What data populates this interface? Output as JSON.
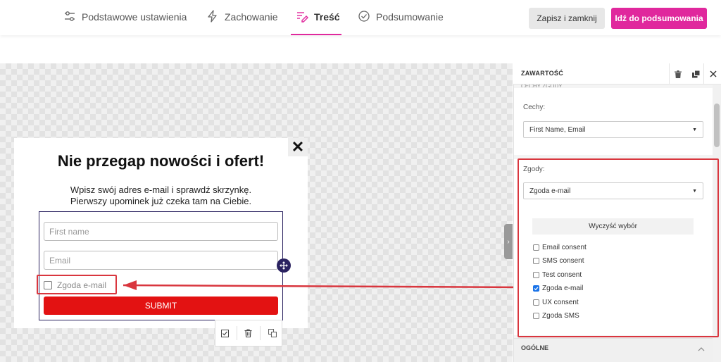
{
  "top_tabs": [
    {
      "label": "Podstawowe ustawienia",
      "icon": "sliders-icon"
    },
    {
      "label": "Zachowanie",
      "icon": "lightning-icon"
    },
    {
      "label": "Treść",
      "icon": "content-edit-icon",
      "active": true
    },
    {
      "label": "Podsumowanie",
      "icon": "check-circle-icon"
    }
  ],
  "buttons": {
    "save_close": "Zapisz i zamknij",
    "go_summary": "Idź do podsumowania"
  },
  "colors": {
    "accent": "#e0289d",
    "submit": "#e31212",
    "highlight": "#d9363e",
    "form_border": "#2a2260"
  },
  "popup": {
    "title": "Nie przegap nowości i ofert!",
    "subtitle_line1": "Wpisz swój adres e-mail i sprawdź skrzynkę.",
    "subtitle_line2": "Pierwszy upominek już czeka tam na Ciebie.",
    "first_name_placeholder": "First name",
    "email_placeholder": "Email",
    "consent_label": "Zgoda e-mail",
    "submit_label": "SUBMIT",
    "close_glyph": "✕"
  },
  "panel": {
    "title": "ZAWARTOŚĆ",
    "partial_section": "CECHY ZGODY",
    "cechy_label": "Cechy:",
    "cechy_value": "First Name, Email",
    "zgody_label": "Zgody:",
    "zgody_value": "Zgoda e-mail",
    "clear_label": "Wyczyść wybór",
    "options": [
      {
        "label": "Email consent",
        "checked": false
      },
      {
        "label": "SMS consent",
        "checked": false
      },
      {
        "label": "Test consent",
        "checked": false
      },
      {
        "label": "Zgoda e-mail",
        "checked": true
      },
      {
        "label": "UX consent",
        "checked": false
      },
      {
        "label": "Zgoda SMS",
        "checked": false
      }
    ],
    "general_section": "OGÓLNE"
  }
}
